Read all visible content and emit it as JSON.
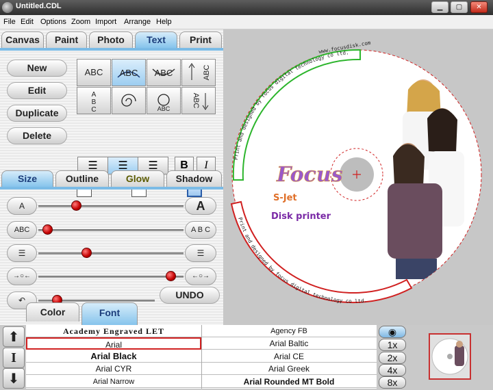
{
  "window": {
    "title": "Untitled.CDL"
  },
  "menu": [
    "File",
    "Edit",
    "Options",
    "Zoom",
    "Import",
    "Arrange",
    "Help"
  ],
  "tabs": [
    "Canvas",
    "Paint",
    "Photo",
    "Text",
    "Print"
  ],
  "actions": {
    "new": "New",
    "edit": "Edit",
    "duplicate": "Duplicate",
    "delete": "Delete"
  },
  "text_styles": [
    "ABC",
    "ABC",
    "ABC",
    "ABC",
    "A B C",
    "ABC",
    "ABC",
    "ABC"
  ],
  "format": {
    "bold": "B",
    "italic": "I"
  },
  "effects": [
    "Size",
    "Outline",
    "Glow",
    "Shadow"
  ],
  "sliders": {
    "size": {
      "left": "A",
      "right": "A",
      "value": 0.26
    },
    "spacing": {
      "left": "ABC",
      "right": "A B C",
      "value": 0.06
    },
    "lines": {
      "value": 0.33
    },
    "offset": {
      "value": 0.91
    }
  },
  "undo_label": "UNDO",
  "bottom_tabs": [
    "Color",
    "Font"
  ],
  "fonts": [
    [
      "Academy Engraved LET",
      "Agency FB"
    ],
    [
      "Arial",
      "Arial Baltic"
    ],
    [
      "Arial Black",
      "Arial CE"
    ],
    [
      "Arial CYR",
      "Arial Greek"
    ],
    [
      "Arial Narrow",
      "Arial Rounded MT Bold"
    ]
  ],
  "selected_font": "Arial",
  "zoom_levels": [
    "1x",
    "2x",
    "4x",
    "8x"
  ],
  "disc": {
    "top_arc_text": "www.focusdisk.com",
    "left_arc_text": "Print and designed by focus digital technology co ltd.",
    "bottom_arc_text": "Print and designed by focus digital technology co ltd.",
    "title": "Focus",
    "line1": "S-Jet",
    "line2": "Disk printer"
  },
  "colors": {
    "accent": "#86c4ec",
    "selected_border": "#d02020",
    "arc_green": "#2cb52c",
    "arc_red": "#d02020"
  }
}
